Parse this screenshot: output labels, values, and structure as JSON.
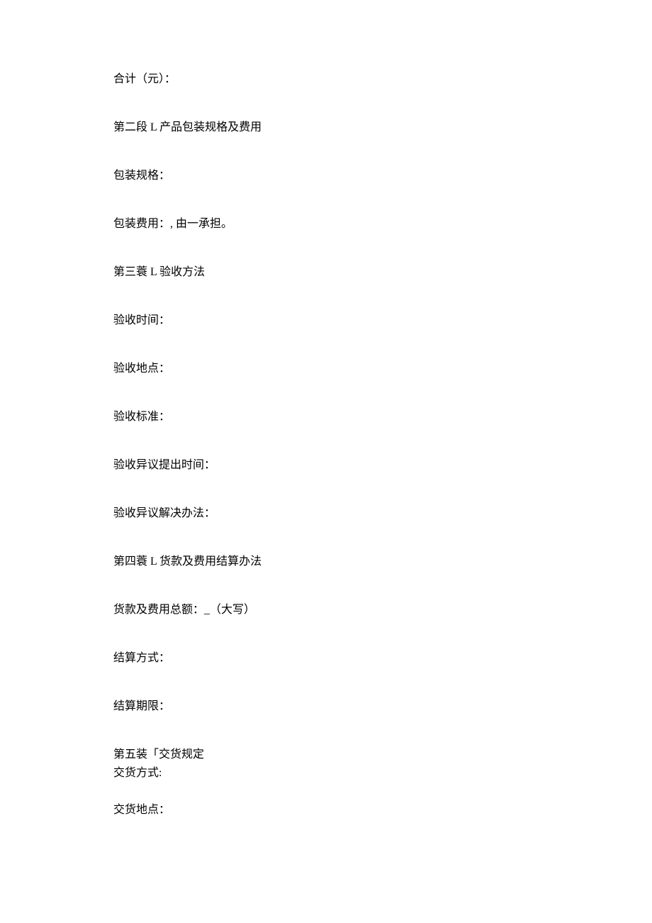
{
  "lines": {
    "l1": "合计（元）：",
    "l2": "第二段 L 产品包装规格及费用",
    "l3": "包装规格：",
    "l4": "包装费用：, 由一承担。",
    "l5": "第三蓑 L 验收方法",
    "l6": "验收时间：",
    "l7": "验收地点：",
    "l8": "验收标准：",
    "l9": "验收异议提出时间：",
    "l10": "验收异议解决办法：",
    "l11": "第四蓑 L 货款及费用结算办法",
    "l12": "货款及费用总额：_（大写）",
    "l13": "结算方式：",
    "l14": "结算期限：",
    "l15": "第五装「交货规定",
    "l16": "交货方式:",
    "l17": "交货地点："
  }
}
